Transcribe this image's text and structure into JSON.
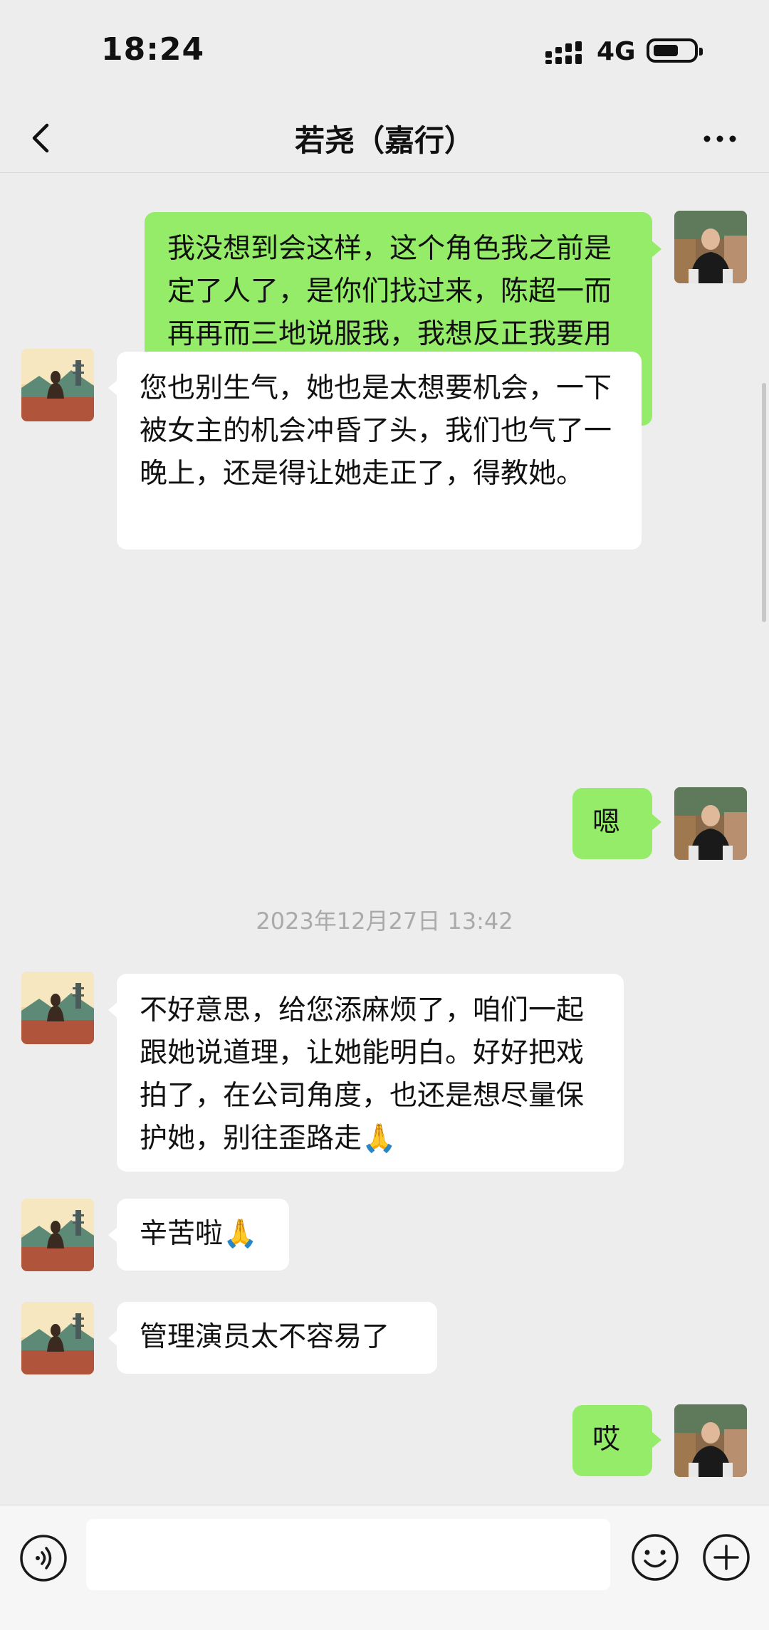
{
  "status_bar": {
    "time": "18:24",
    "network": "4G"
  },
  "header": {
    "title": "若尧（嘉行）"
  },
  "messages": [
    {
      "from": "me",
      "text": "我没想到会这样，这个角色我之前是定了人了，是你们找过来，陈超一而再再而三地说服我，我想反正我要用新人，预算也不够，才同意了，结果开机在即突然放我鸽子，一个演员人品如此之差，如此之不讲诚信，以后怎么混？"
    },
    {
      "from": "them",
      "text": "您也别生气，她也是太想要机会，一下被女主的机会冲昏了头，我们也气了一晚上，还是得让她走正了，得教她。"
    },
    {
      "from": "me",
      "text": "嗯"
    },
    {
      "timestamp": "2023年12月27日 13:42"
    },
    {
      "from": "them",
      "text": "不好意思，给您添麻烦了，咱们一起跟她说道理，让她能明白。好好把戏拍了，在公司角度，也还是想尽量保护她，别往歪路走🙏"
    },
    {
      "from": "them",
      "text": "辛苦啦🙏"
    },
    {
      "from": "them",
      "text": "管理演员太不容易了"
    },
    {
      "from": "me",
      "text": "哎"
    }
  ],
  "colors": {
    "self_bubble": "#95ec69",
    "other_bubble": "#ffffff",
    "background": "#ededed"
  },
  "input_bar": {
    "placeholder": ""
  },
  "icons": [
    "back-arrow-icon",
    "more-dots-icon",
    "voice-icon",
    "emoji-icon",
    "plus-icon",
    "signal-icon",
    "battery-icon"
  ]
}
